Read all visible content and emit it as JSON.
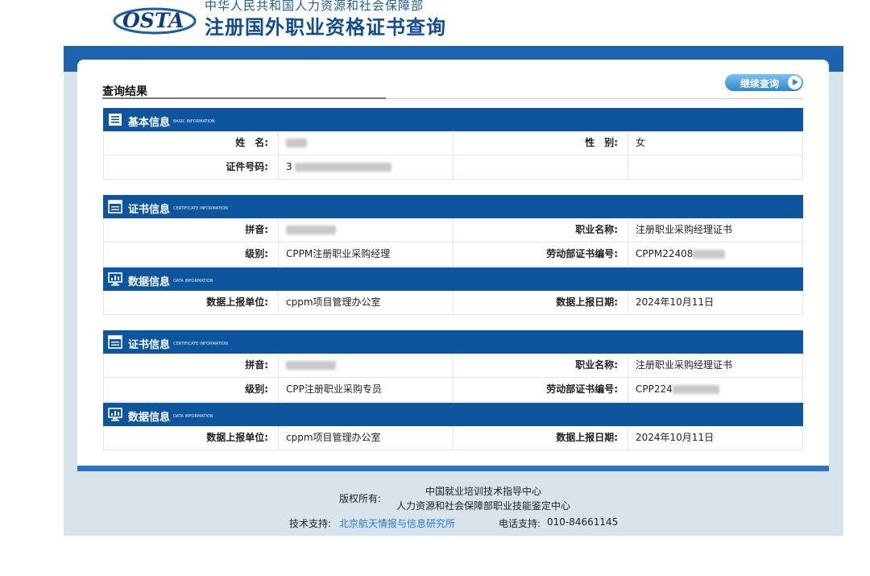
{
  "header": {
    "logo_text": "OSTA",
    "ministry": "中华人民共和国人力资源和社会保障部",
    "title": "注册国外职业资格证书查询"
  },
  "result": {
    "title": "查询结果",
    "continue_label": "继续查询"
  },
  "colors": {
    "primary": "#0d569e",
    "band": "#1c64ad",
    "link": "#2a7bc8",
    "button": "#2d86cf"
  },
  "basic": {
    "title": "基本信息",
    "title_en": "BASIC INFORMATION",
    "icon": "list-icon",
    "name_label": "姓　名:",
    "name_value": "",
    "gender_label": "性　别:",
    "gender_value": "女",
    "id_label": "证件号码:",
    "id_value": "3"
  },
  "cert1": {
    "title": "证书信息",
    "title_en": "CERTIFICATE INFORMATION",
    "icon": "certificate-icon",
    "pinyin_label": "拼音:",
    "pinyin_value": "",
    "occupation_label": "职业名称:",
    "occupation_value": "注册职业采购经理证书",
    "level_label": "级别:",
    "level_value": "CPPM注册职业采购经理",
    "cert_no_label": "劳动部证书编号:",
    "cert_no_value": "CPPM22408"
  },
  "data1": {
    "title": "数据信息",
    "title_en": "DATA INFORMATION",
    "icon": "monitor-chart-icon",
    "unit_label": "数据上报单位:",
    "unit_value": "cppm项目管理办公室",
    "date_label": "数据上报日期:",
    "date_value": "2024年10月11日"
  },
  "cert2": {
    "title": "证书信息",
    "title_en": "CERTIFICATE INFORMATION",
    "icon": "certificate-icon",
    "pinyin_label": "拼音:",
    "pinyin_value": "",
    "occupation_label": "职业名称:",
    "occupation_value": "注册职业采购经理证书",
    "level_label": "级别:",
    "level_value": "CPP注册职业采购专员",
    "cert_no_label": "劳动部证书编号:",
    "cert_no_value": "CPP224"
  },
  "data2": {
    "title": "数据信息",
    "title_en": "DATA INFORMATION",
    "icon": "monitor-chart-icon",
    "unit_label": "数据上报单位:",
    "unit_value": "cppm项目管理办公室",
    "date_label": "数据上报日期:",
    "date_value": "2024年10月11日"
  },
  "footer": {
    "copyright_label": "版权所有:",
    "org1": "中国就业培训技术指导中心",
    "org2": "人力资源和社会保障部职业技能鉴定中心",
    "tech_label": "技术支持:",
    "tech_link": "北京航天情报与信息研究所",
    "phone_label": "电话支持:",
    "phone": "010-84661145"
  }
}
